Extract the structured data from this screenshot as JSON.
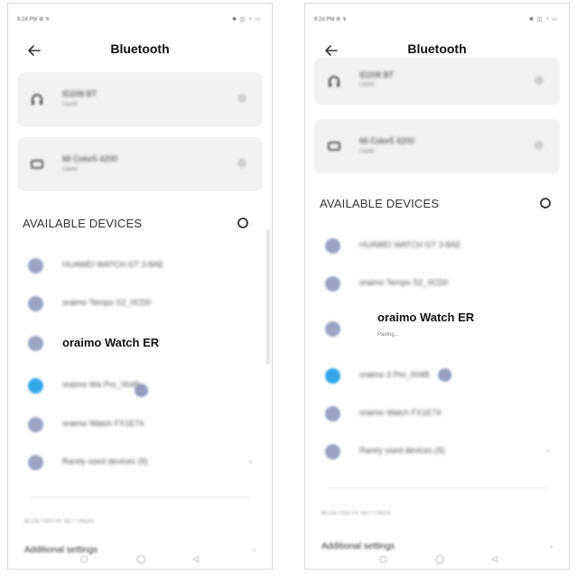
{
  "colors": {
    "accent_blue": "#33a6e8",
    "device_dot": "#8a93b8",
    "card_bg": "#f2f2f2"
  },
  "left": {
    "status": {
      "time": "6:24 PM ⚙ ↯",
      "icons": "✱ ◫ ◔ ▭"
    },
    "title": "Bluetooth",
    "saved": [
      {
        "name": "ID208 BT",
        "sub": "Saved",
        "icon": "headphones-icon"
      },
      {
        "name": "Mi Color5 4200",
        "sub": "Saved",
        "icon": "watch-icon"
      }
    ],
    "available_header": "AVAILABLE DEVICES",
    "devices": [
      {
        "name": "HUAWEI WATCH GT 3-8AE"
      },
      {
        "name": "oraimo Tempo S2_0CD0"
      },
      {
        "name": "oraimo Watch ER"
      },
      {
        "name": "oraimo Wa        Pro_004B"
      },
      {
        "name": "oraimo Watch FX1E74"
      },
      {
        "name": "Rarely used devices (9)"
      }
    ],
    "settings_label": "BLUETOOTH SETTINGS",
    "settings_item": "Additional settings",
    "nav": [
      "▢",
      "◯",
      "◁"
    ]
  },
  "right": {
    "status": {
      "time": "6:24 PM ⚙ ↯",
      "icons": "✱ ◫ ◔ ▭"
    },
    "title": "Bluetooth",
    "saved": [
      {
        "name": "ID208 BT",
        "sub": "Saved",
        "icon": "headphones-icon"
      },
      {
        "name": "Mi Color5 4200",
        "sub": "Saved",
        "icon": "watch-icon"
      }
    ],
    "available_header": "AVAILABLE DEVICES",
    "devices": [
      {
        "name": "HUAWEI WATCH GT 3-8AE"
      },
      {
        "name": "oraimo Tempo S2_0CD0"
      },
      {
        "name": "oraimo Watch ER",
        "status": "Pairing..."
      },
      {
        "name": "oraimo         3 Pro_004B"
      },
      {
        "name": "oraimo Watch FX1E74"
      },
      {
        "name": "Rarely used devices (9)"
      }
    ],
    "settings_label": "BLUETOOTH SETTINGS",
    "settings_item": "Additional settings",
    "nav": [
      "▢",
      "◯",
      "◁"
    ]
  }
}
